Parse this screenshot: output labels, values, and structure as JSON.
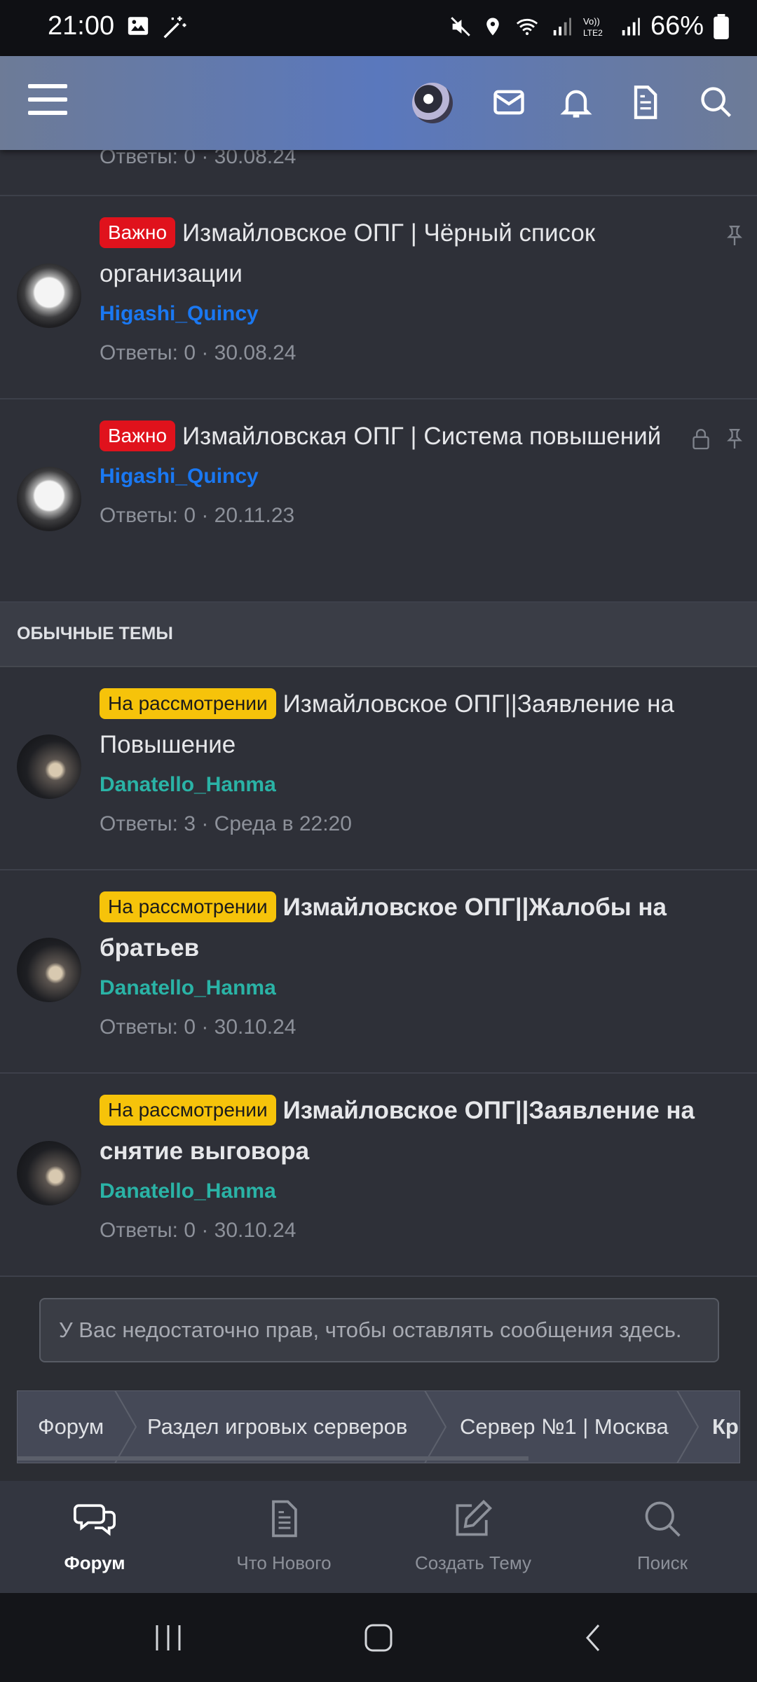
{
  "status_bar": {
    "time": "21:00",
    "battery": "66%"
  },
  "app_bar": {
    "menu_icon": "hamburger-menu-icon",
    "icons": [
      "avatar",
      "mail-icon",
      "bell-icon",
      "document-icon",
      "search-icon"
    ]
  },
  "top_partial": {
    "meta": "Ответы: 0 · 30.08.24"
  },
  "threads": [
    {
      "badge": "Важно",
      "title": "Измайловское ОПГ | Чёрный список организации",
      "author": "Higashi_Quincy",
      "meta": "Ответы: 0 · 30.08.24"
    },
    {
      "badge": "Важно",
      "title": "Измайловская ОПГ | Система повышений",
      "author": "Higashi_Quincy",
      "meta": "Ответы: 0 · 20.11.23"
    }
  ],
  "section": {
    "title": "ОБЫЧНЫЕ ТЕМЫ"
  },
  "normal_threads": [
    {
      "badge": "На рассмотрении",
      "title": "Измайловское ОПГ||Заявление на Повышение",
      "author": "Danatello_Hanma",
      "meta": "Ответы: 3 · Среда в 22:20"
    },
    {
      "badge": "На рассмотрении",
      "title": "Измайловское ОПГ||Жалобы на братьев",
      "author": "Danatello_Hanma",
      "meta": "Ответы: 0 · 30.10.24"
    },
    {
      "badge": "На рассмотрении",
      "title": "Измайловское ОПГ||Заявление на снятие выговора",
      "author": "Danatello_Hanma",
      "meta": "Ответы: 0 · 30.10.24"
    }
  ],
  "notice": "У Вас недостаточно прав, чтобы оставлять сообщения здесь.",
  "breadcrumb": [
    "Форум",
    "Раздел игровых серверов",
    "Сервер №1 | Москва",
    "Кр"
  ],
  "bottom_nav": [
    {
      "label": "Форум",
      "icon": "chat-bubbles-icon"
    },
    {
      "label": "Что Нового",
      "icon": "document-icon"
    },
    {
      "label": "Создать Тему",
      "icon": "edit-icon"
    },
    {
      "label": "Поиск",
      "icon": "search-icon"
    }
  ],
  "colors": {
    "important_badge": "#e0121c",
    "review_badge": "#f6c30a",
    "author_blue": "#1a78f2",
    "author_teal": "#2ab3a6"
  }
}
